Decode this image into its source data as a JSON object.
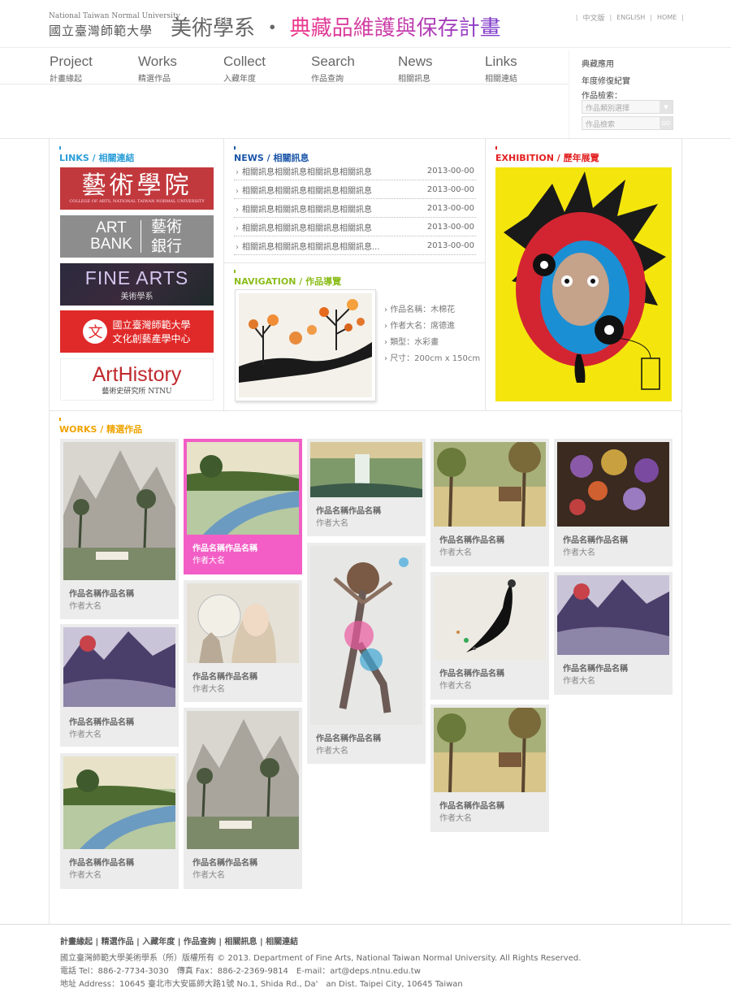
{
  "header": {
    "university_en": "National Taiwan Normal University",
    "university_zh": "國立臺灣師範大學",
    "dept_title": "美術學系",
    "title_sep": "‧",
    "project_title": "典藏品維護與保存計畫",
    "top_links": [
      "中文版",
      "ENGLISH",
      "HOME"
    ]
  },
  "nav": [
    {
      "en": "Project",
      "zh": "計畫緣起"
    },
    {
      "en": "Works",
      "zh": "精選作品"
    },
    {
      "en": "Collect",
      "zh": "入藏年度"
    },
    {
      "en": "Search",
      "zh": "作品查詢"
    },
    {
      "en": "News",
      "zh": "相關訊息"
    },
    {
      "en": "Links",
      "zh": "相關連結"
    }
  ],
  "side": {
    "link1": "典藏應用",
    "link2": "年度修復紀實",
    "search_label": "作品檢索：",
    "category_placeholder": "作品類別選擇",
    "keyword_placeholder": "作品檢索",
    "go_label": "GO"
  },
  "links_section": {
    "title_en": "LINKS",
    "title_sep": " / ",
    "title_zh": "相關連結",
    "banners": [
      {
        "main": "藝術學院",
        "sub": "COLLEGE OF ARTS, NATIONAL TAIWAN NORMAL UNIVERSITY"
      },
      {
        "left": "ART BANK",
        "right": "藝術 銀行"
      },
      {
        "main": "FINE ARTS",
        "sub": "美術學系"
      },
      {
        "main": "國立臺灣師範大學",
        "sub": "文化創藝產學中心"
      },
      {
        "main": "ArtHistory",
        "sub": "藝術史研究所 NTNU"
      }
    ]
  },
  "news_section": {
    "title_en": "NEWS",
    "title_sep": " / ",
    "title_zh": "相關訊息",
    "items": [
      {
        "text": "相關訊息相關訊息相關訊息相關訊息",
        "date": "2013-00-00"
      },
      {
        "text": "相關訊息相關訊息相關訊息相關訊息",
        "date": "2013-00-00"
      },
      {
        "text": "相關訊息相關訊息相關訊息相關訊息",
        "date": "2013-00-00"
      },
      {
        "text": "相關訊息相關訊息相關訊息相關訊息",
        "date": "2013-00-00"
      },
      {
        "text": "相關訊息相關訊息相關訊息相關訊息...",
        "date": "2013-00-00"
      }
    ]
  },
  "navigation_section": {
    "title_en": "NAVIGATION",
    "title_sep": " / ",
    "title_zh": "作品導覽",
    "details": [
      "作品名稱：木棉花",
      "作者大名：席德進",
      "類型：水彩畫",
      "尺寸：200cm x 150cm"
    ]
  },
  "exhibition_section": {
    "title_en": "EXHIBITION",
    "title_sep": " / ",
    "title_zh": "歷年展覽"
  },
  "works_section": {
    "title_en": "WORKS",
    "title_sep": " / ",
    "title_zh": "精選作品",
    "item_name": "作品名稱作品名稱",
    "item_author": "作者大名"
  },
  "footer": {
    "links": [
      "計畫緣起",
      "精選作品",
      "入藏年度",
      "作品查詢",
      "相關訊息",
      "相關連結"
    ],
    "copyright": "國立臺灣師範大學美術學系（所）版權所有 © 2013. Department of Fine Arts, National Taiwan Normal University. All Rights Reserved.",
    "contact": "電話 Tel：886-2-7734-3030　傳真 Fax：886-2-2369-9814　E-mail：art@deps.ntnu.edu.tw",
    "address": "地址 Address：10645 臺北市大安區師大路1號  No.1, Shida Rd., Da'　an Dist. Taipei City, 10645 Taiwan"
  },
  "colors": {
    "links": "#2c9ed8",
    "news": "#1a55a8",
    "navigation": "#8bbd1b",
    "exhibition": "#e32020",
    "works": "#f0a400",
    "active_card": "#f25ec5"
  }
}
